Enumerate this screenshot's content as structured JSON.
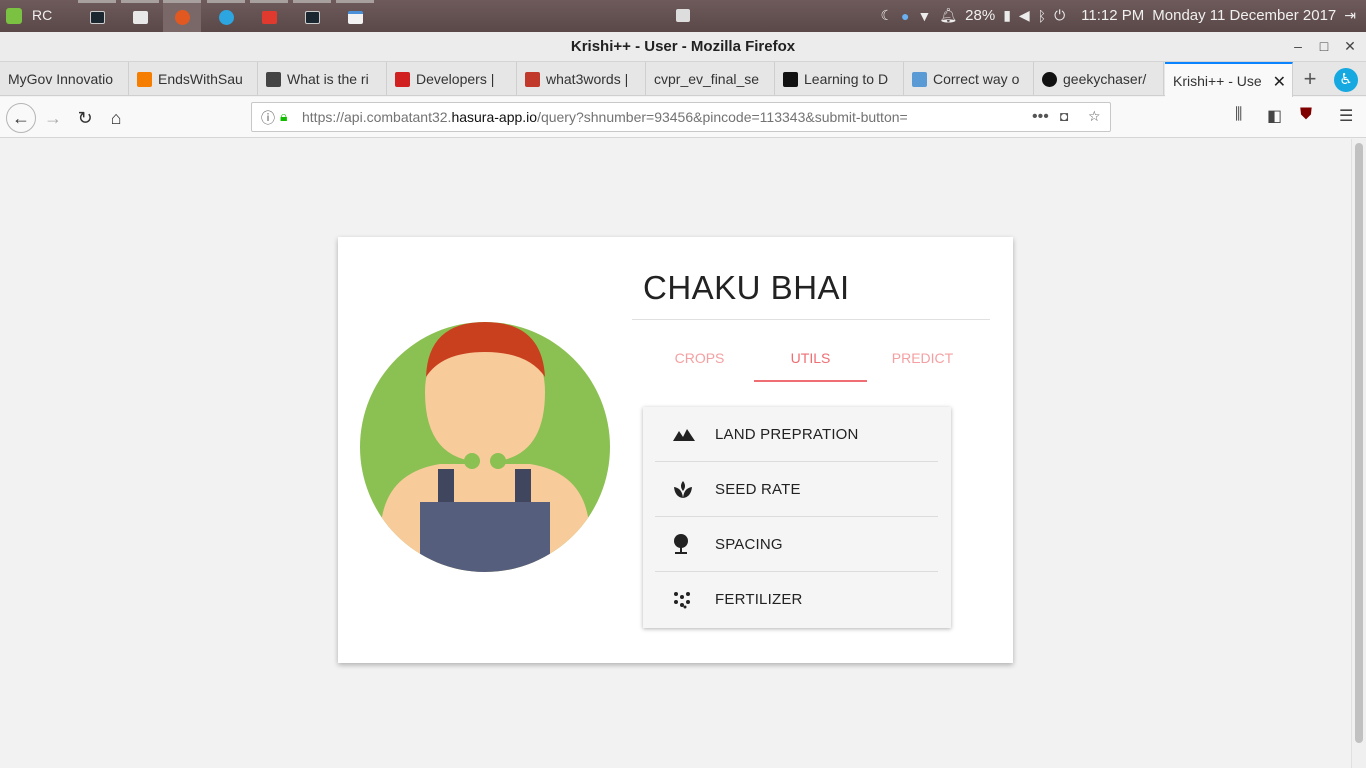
{
  "os": {
    "label": "RC",
    "battery": "28%",
    "clock": "11:12 PM",
    "date": "Monday 11 December 2017"
  },
  "window": {
    "title": "Krishi++ - User - Mozilla Firefox"
  },
  "tabs": [
    {
      "label": "MyGov Innovatio",
      "favicon": "mygov-icon",
      "color": "#ffffff"
    },
    {
      "label": "EndsWithSau",
      "favicon": "blogger-icon",
      "color": "#f57d00"
    },
    {
      "label": "What is the ri",
      "favicon": "cube-icon",
      "color": "#444444"
    },
    {
      "label": "Developers |",
      "favicon": "developers-icon",
      "color": "#d02020"
    },
    {
      "label": "what3words |",
      "favicon": "what3words-icon",
      "color": "#c0392b"
    },
    {
      "label": "cvpr_ev_final_se",
      "favicon": "",
      "color": ""
    },
    {
      "label": "Learning to D",
      "favicon": "medium-icon",
      "color": "#111111"
    },
    {
      "label": "Correct way o",
      "favicon": "chart-favicon-icon",
      "color": "#5b9bd5"
    },
    {
      "label": "geekychaser/",
      "favicon": "github-icon",
      "color": "#111111"
    },
    {
      "label": "Krishi++ - Use",
      "favicon": "",
      "color": "",
      "active": true
    }
  ],
  "urlbar": {
    "prefix": "https://api.combatant32.",
    "host": "hasura-app.io",
    "suffix": "/query?shnumber=93456&pincode=113343&submit-button="
  },
  "profile": {
    "name": "CHAKU BHAI",
    "tabs": [
      "CROPS",
      "UTILS",
      "PREDICT"
    ],
    "active_tab": "UTILS",
    "utils": [
      {
        "label": "LAND PREPRATION",
        "icon": "landscape-icon"
      },
      {
        "label": "SEED RATE",
        "icon": "spa-icon"
      },
      {
        "label": "SPACING",
        "icon": "nature-icon"
      },
      {
        "label": "FERTILIZER",
        "icon": "grain-icon"
      }
    ]
  },
  "colors": {
    "accent": "#ee6e73",
    "accent_light": "#f4a0a3",
    "avatar_bg": "#8bc052",
    "hair": "#c9401e",
    "skin": "#f8cb9b",
    "overalls": "#555e7d"
  }
}
